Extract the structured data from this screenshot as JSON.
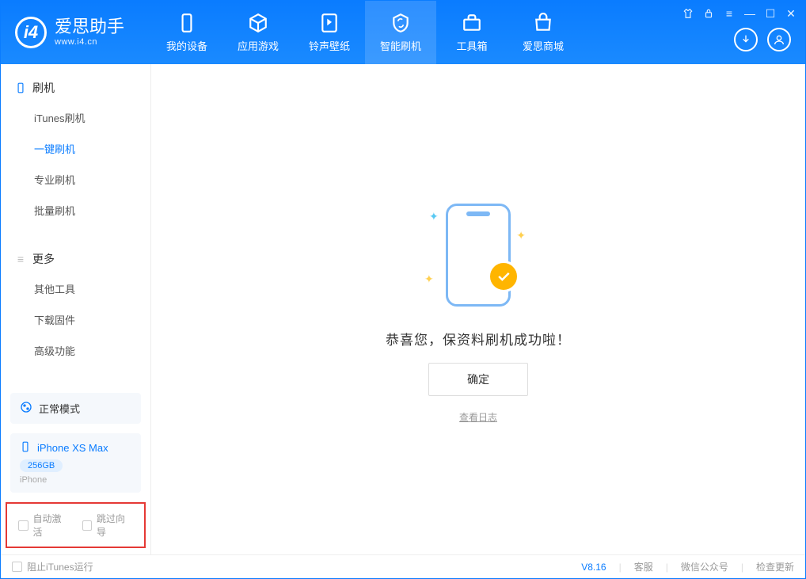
{
  "app": {
    "title": "爱思助手",
    "subtitle": "www.i4.cn"
  },
  "nav": {
    "items": [
      {
        "label": "我的设备"
      },
      {
        "label": "应用游戏"
      },
      {
        "label": "铃声壁纸"
      },
      {
        "label": "智能刷机"
      },
      {
        "label": "工具箱"
      },
      {
        "label": "爱思商城"
      }
    ]
  },
  "sidebar": {
    "flash_section": {
      "title": "刷机"
    },
    "flash_items": [
      {
        "label": "iTunes刷机"
      },
      {
        "label": "一键刷机"
      },
      {
        "label": "专业刷机"
      },
      {
        "label": "批量刷机"
      }
    ],
    "more_section": {
      "title": "更多"
    },
    "more_items": [
      {
        "label": "其他工具"
      },
      {
        "label": "下载固件"
      },
      {
        "label": "高级功能"
      }
    ],
    "status": {
      "label": "正常模式"
    },
    "device": {
      "name": "iPhone XS Max",
      "storage": "256GB",
      "type": "iPhone"
    },
    "checkboxes": {
      "auto_activate": "自动激活",
      "skip_guide": "跳过向导"
    }
  },
  "main": {
    "success_message": "恭喜您，保资料刷机成功啦！",
    "ok_button": "确定",
    "view_log": "查看日志"
  },
  "footer": {
    "block_itunes": "阻止iTunes运行",
    "version": "V8.16",
    "support": "客服",
    "wechat": "微信公众号",
    "check_update": "检查更新"
  }
}
